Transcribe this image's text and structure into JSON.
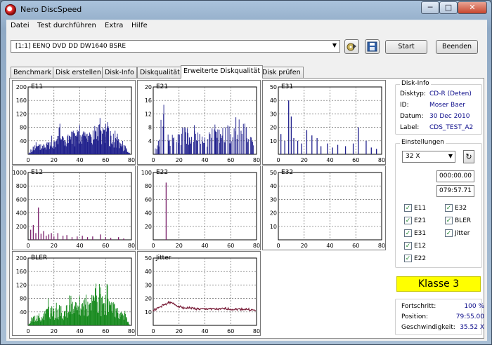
{
  "window": {
    "title": "Nero DiscSpeed",
    "controls": [
      "─",
      "□",
      "✕"
    ]
  },
  "menu": [
    "Datei",
    "Test durchführen",
    "Extra",
    "Hilfe"
  ],
  "toolbar": {
    "drive": "[1:1]  EENQ DVD DD DW1640 BSRE",
    "start_label": "Start",
    "exit_label": "Beenden"
  },
  "tabs": [
    "Benchmark",
    "Disk erstellen",
    "Disk-Info",
    "Diskqualität",
    "Erweiterte Diskqualität",
    "Disk prüfen"
  ],
  "active_tab": 4,
  "chart_data": [
    {
      "type": "bar",
      "title": "E11",
      "ylim": [
        0,
        200
      ],
      "yticks": [
        40,
        80,
        120,
        160,
        200
      ],
      "xticks": [
        0,
        20,
        40,
        60,
        80
      ],
      "color": "#1f1f8c",
      "shape": "dense",
      "x": [
        0,
        4,
        8,
        12,
        16,
        20,
        24,
        28,
        32,
        36,
        40,
        44,
        48,
        52,
        56,
        60,
        64,
        68,
        72,
        76,
        79
      ],
      "values": [
        0,
        22,
        25,
        30,
        35,
        38,
        80,
        42,
        55,
        60,
        58,
        65,
        60,
        70,
        72,
        90,
        55,
        45,
        30,
        18,
        0
      ]
    },
    {
      "type": "bar",
      "title": "E21",
      "ylim": [
        0,
        20
      ],
      "yticks": [
        4,
        8,
        12,
        16,
        20
      ],
      "xticks": [
        0,
        20,
        40,
        60,
        80
      ],
      "color": "#1f1f8c",
      "shape": "spiky",
      "x": [
        0,
        4,
        8,
        12,
        16,
        20,
        24,
        28,
        32,
        36,
        40,
        44,
        48,
        52,
        56,
        60,
        64,
        68,
        72,
        76,
        79
      ],
      "values": [
        0,
        4,
        12,
        4,
        5,
        6,
        8,
        5,
        7,
        6,
        5,
        6,
        7,
        6,
        8,
        6,
        11,
        7,
        8,
        5,
        0
      ]
    },
    {
      "type": "bar",
      "title": "E31",
      "ylim": [
        0,
        50
      ],
      "yticks": [
        10,
        20,
        30,
        40,
        50
      ],
      "xticks": [
        0,
        20,
        40,
        60,
        80
      ],
      "color": "#1f1f8c",
      "shape": "sparse",
      "x": [
        2,
        5,
        8,
        10,
        12,
        15,
        18,
        22,
        26,
        30,
        33,
        38,
        42,
        46,
        52,
        58,
        62,
        68,
        72,
        76
      ],
      "values": [
        15,
        10,
        40,
        28,
        12,
        10,
        8,
        18,
        14,
        12,
        6,
        8,
        5,
        7,
        6,
        8,
        20,
        10,
        5,
        4
      ]
    },
    {
      "type": "bar",
      "title": "E12",
      "ylim": [
        0,
        1000
      ],
      "yticks": [
        200,
        400,
        600,
        800,
        1000
      ],
      "xticks": [
        0,
        20,
        40,
        60,
        80
      ],
      "color": "#7a1f6a",
      "shape": "sparse",
      "x": [
        2,
        4,
        6,
        8,
        10,
        12,
        14,
        16,
        18,
        20,
        23,
        27,
        30,
        34,
        38,
        42,
        46,
        50,
        56,
        60,
        64,
        70,
        74
      ],
      "values": [
        150,
        220,
        100,
        480,
        90,
        130,
        60,
        80,
        100,
        50,
        100,
        60,
        70,
        40,
        50,
        60,
        40,
        50,
        80,
        40,
        30,
        40,
        20
      ]
    },
    {
      "type": "bar",
      "title": "E22",
      "ylim": [
        0,
        100
      ],
      "yticks": [
        20,
        40,
        60,
        80,
        100
      ],
      "xticks": [
        0,
        20,
        40,
        60,
        80
      ],
      "color": "#7a1f6a",
      "shape": "sparse",
      "x": [
        10
      ],
      "values": [
        85
      ]
    },
    {
      "type": "bar",
      "title": "E32",
      "ylim": [
        0,
        50
      ],
      "yticks": [
        10,
        20,
        30,
        40,
        50
      ],
      "xticks": [
        0,
        20,
        40,
        60,
        80
      ],
      "color": "#1f1f8c",
      "shape": "sparse",
      "x": [],
      "values": []
    },
    {
      "type": "bar",
      "title": "BLER",
      "ylim": [
        0,
        200
      ],
      "yticks": [
        40,
        80,
        120,
        160,
        200
      ],
      "xticks": [
        0,
        20,
        40,
        60,
        80
      ],
      "color": "#15891c",
      "shape": "dense",
      "x": [
        0,
        4,
        8,
        12,
        16,
        20,
        24,
        28,
        32,
        36,
        40,
        44,
        48,
        52,
        56,
        60,
        64,
        68,
        72,
        76,
        79
      ],
      "values": [
        0,
        25,
        28,
        35,
        55,
        40,
        50,
        42,
        60,
        55,
        58,
        80,
        60,
        110,
        75,
        90,
        60,
        50,
        40,
        25,
        0
      ]
    },
    {
      "type": "line",
      "title": "Jitter",
      "ylim": [
        0,
        50
      ],
      "yticks": [
        10,
        20,
        30,
        40,
        50
      ],
      "xticks": [
        0,
        20,
        40,
        60,
        80
      ],
      "color": "#7a1f3a",
      "x": [
        0,
        4,
        8,
        12,
        16,
        20,
        24,
        28,
        32,
        36,
        40,
        44,
        48,
        52,
        56,
        60,
        64,
        68,
        72,
        76,
        79
      ],
      "values": [
        11,
        13,
        15,
        17,
        16,
        14,
        13,
        13,
        12.5,
        12,
        12,
        12.5,
        12,
        12,
        12.5,
        12,
        12,
        12,
        12,
        11.5,
        11
      ]
    }
  ],
  "disk_info": {
    "title": "Disk-Info",
    "rows": [
      {
        "label": "Disktyp:",
        "value": "CD-R (Deten)"
      },
      {
        "label": "ID:",
        "value": "Moser Baer"
      },
      {
        "label": "Datum:",
        "value": "30 Dec 2010"
      },
      {
        "label": "Label:",
        "value": "CDS_TEST_A2"
      }
    ]
  },
  "settings": {
    "title": "Einstellungen",
    "speed": "32 X",
    "refresh_icon": "↻",
    "time_start": "000:00.00",
    "time_end": "079:57.71",
    "checkboxes": [
      {
        "label": "E11",
        "checked": "✓"
      },
      {
        "label": "E32",
        "checked": "✓"
      },
      {
        "label": "E21",
        "checked": "✓"
      },
      {
        "label": "BLER",
        "checked": "✓"
      },
      {
        "label": "E31",
        "checked": "✓"
      },
      {
        "label": "Jitter",
        "checked": "✓"
      },
      {
        "label": "E12",
        "checked": "✓"
      },
      {
        "label": "E22",
        "checked": "✓"
      }
    ]
  },
  "klasse": "Klasse 3",
  "status": {
    "rows": [
      {
        "label": "Fortschritt:",
        "value": "100 %"
      },
      {
        "label": "Position:",
        "value": "79:55.00"
      },
      {
        "label": "Geschwindigkeit:",
        "value": "35.52 X"
      }
    ]
  }
}
